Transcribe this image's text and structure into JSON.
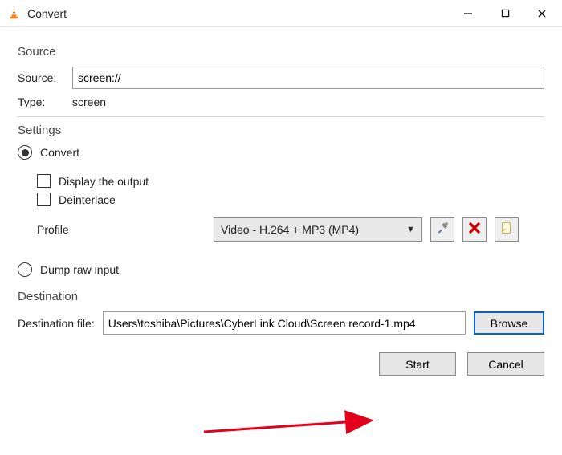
{
  "window": {
    "title": "Convert"
  },
  "source": {
    "section_label": "Source",
    "source_label": "Source:",
    "source_value": "screen://",
    "type_label": "Type:",
    "type_value": "screen"
  },
  "settings": {
    "section_label": "Settings",
    "convert_label": "Convert",
    "display_output_label": "Display the output",
    "deinterlace_label": "Deinterlace",
    "profile_label": "Profile",
    "profile_value": "Video - H.264 + MP3 (MP4)",
    "dump_raw_label": "Dump raw input"
  },
  "destination": {
    "section_label": "Destination",
    "dest_label": "Destination file:",
    "dest_value": "Users\\toshiba\\Pictures\\CyberLink Cloud\\Screen record-1.mp4",
    "browse_label": "Browse"
  },
  "footer": {
    "start_label": "Start",
    "cancel_label": "Cancel"
  },
  "icons": {
    "vlc": "vlc-cone-icon",
    "minimize": "—",
    "maximize": "☐",
    "close": "✕",
    "tools": "tools-icon",
    "delete": "delete-icon",
    "new": "new-profile-icon"
  }
}
